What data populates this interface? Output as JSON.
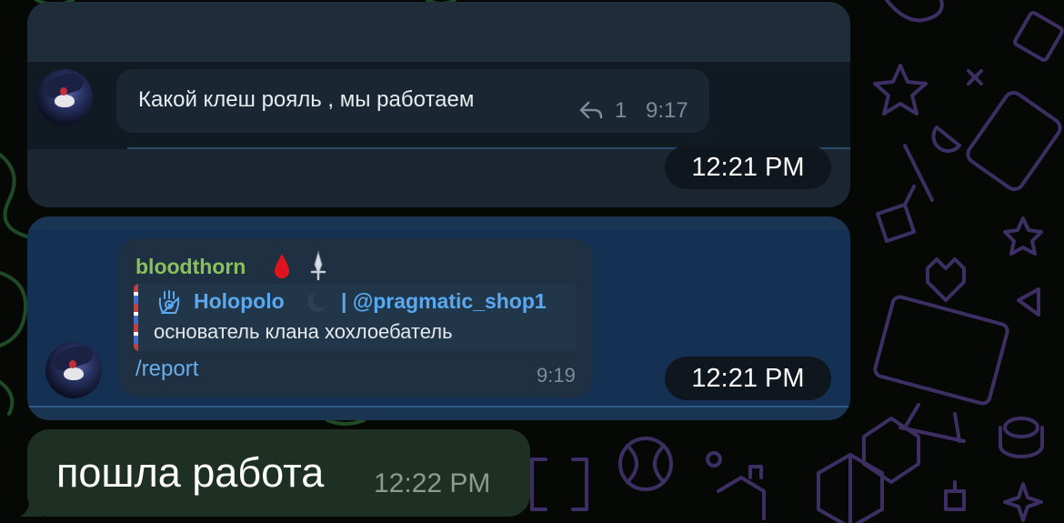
{
  "background_colors": {
    "page": "#050805",
    "doodle_green": "#1f4a26",
    "doodle_purple": "#3d2f63"
  },
  "card1": {
    "message": {
      "text": "Какой клеш рояль , мы работаем",
      "reply_count": "1",
      "time": "9:17"
    },
    "timestamp": "12:21 PM"
  },
  "card2": {
    "message": {
      "sender": "bloodthorn",
      "sender_emojis": [
        "blood-drop-icon",
        "sword-icon"
      ],
      "quote": {
        "name": "Holopolo",
        "handle": "| @pragmatic_shop1",
        "text": "основатель клана хохлоебатель",
        "icons": [
          "hamsa-icon",
          "moon-emoji-icon"
        ]
      },
      "text": "/report",
      "time": "9:19"
    },
    "timestamp": "12:21 PM"
  },
  "my_message": {
    "text": "пошла работа",
    "time": "12:22 PM",
    "bubble_color": "#1e3024"
  },
  "accent_colors": {
    "sender_green": "#8ac15b",
    "link_blue": "#5aa9f0"
  }
}
